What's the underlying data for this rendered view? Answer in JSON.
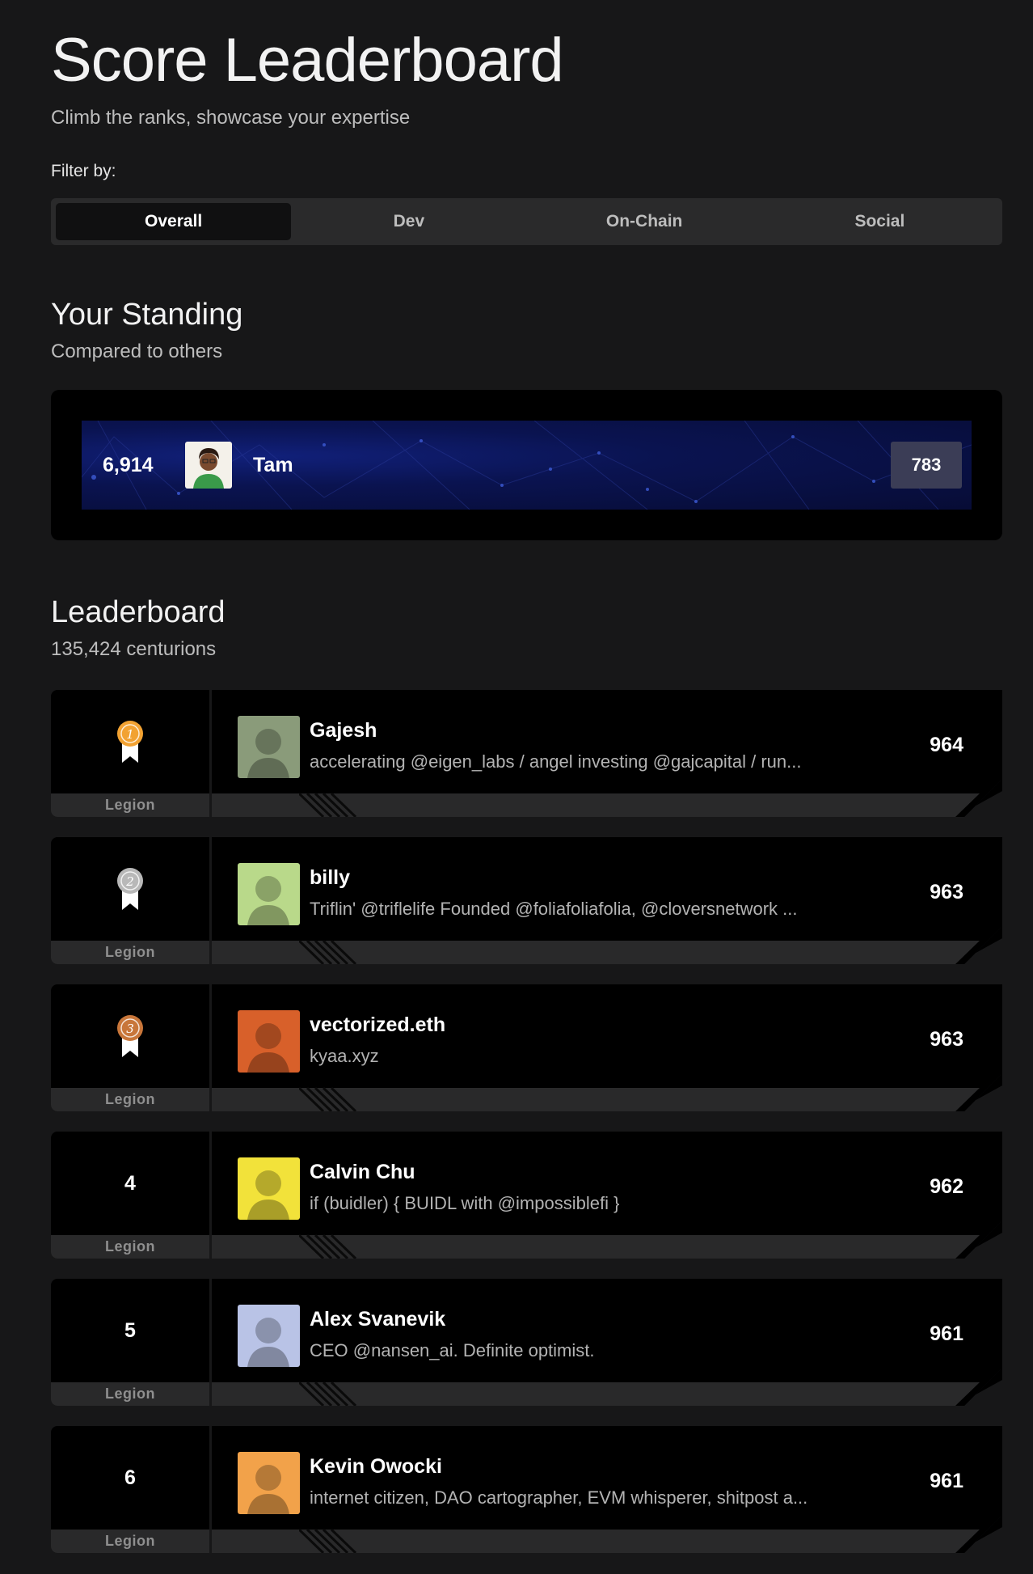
{
  "header": {
    "title": "Score Leaderboard",
    "subtitle": "Climb the ranks, showcase your expertise",
    "filter_label": "Filter by:"
  },
  "filter_tabs": [
    {
      "label": "Overall",
      "active": true
    },
    {
      "label": "Dev",
      "active": false
    },
    {
      "label": "On-Chain",
      "active": false
    },
    {
      "label": "Social",
      "active": false
    }
  ],
  "standing": {
    "title": "Your Standing",
    "subtitle": "Compared to others",
    "rank": "6,914",
    "name": "Tam",
    "score": "783",
    "avatar_icon": "user-avatar-icon"
  },
  "leaderboard": {
    "title": "Leaderboard",
    "count_text": "135,424 centurions",
    "rows": [
      {
        "rank": "1",
        "medal": "gold",
        "tier": "Legion",
        "name": "Gajesh",
        "bio": "accelerating @eigen_labs / angel investing @gajcapital / run...",
        "score": "964",
        "avatar_color": "#8a9b7a"
      },
      {
        "rank": "2",
        "medal": "silver",
        "tier": "Legion",
        "name": "billy",
        "bio": "Triflin' @triflelife Founded @foliafoliafolia, @cloversnetwork ...",
        "score": "963",
        "avatar_color": "#b9d98a"
      },
      {
        "rank": "3",
        "medal": "bronze",
        "tier": "Legion",
        "name": "vectorized.eth",
        "bio": "kyaa.xyz",
        "score": "963",
        "avatar_color": "#d8602a"
      },
      {
        "rank": "4",
        "medal": "",
        "tier": "Legion",
        "name": "Calvin Chu",
        "bio": "if (buidler) { BUIDL with @impossiblefi }",
        "score": "962",
        "avatar_color": "#f2e23a"
      },
      {
        "rank": "5",
        "medal": "",
        "tier": "Legion",
        "name": "Alex Svanevik",
        "bio": "CEO @nansen_ai. Definite optimist.",
        "score": "961",
        "avatar_color": "#b9c3e6"
      },
      {
        "rank": "6",
        "medal": "",
        "tier": "Legion",
        "name": "Kevin Owocki",
        "bio": "internet citizen, DAO cartographer, EVM whisperer, shitpost a...",
        "score": "961",
        "avatar_color": "#f2a24a"
      }
    ]
  },
  "colors": {
    "gold": "#f2a232",
    "silver": "#b8b8b8",
    "bronze": "#c8763a"
  }
}
